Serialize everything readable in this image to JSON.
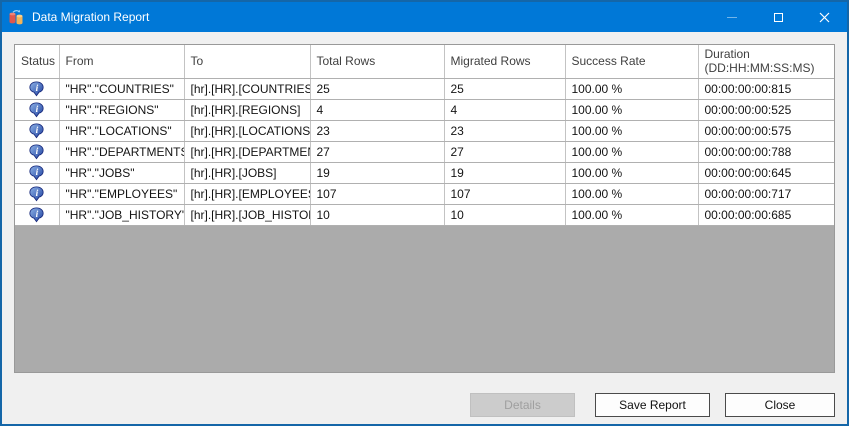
{
  "window": {
    "title": "Data Migration Report",
    "app_icon": "data-migration-icon",
    "controls": {
      "minimize": "minimize",
      "maximize": "maximize",
      "close": "close"
    }
  },
  "table": {
    "columns": [
      "Status",
      "From",
      "To",
      "Total Rows",
      "Migrated Rows",
      "Success Rate",
      "Duration\n(DD:HH:MM:SS:MS)"
    ],
    "status_icon": "info-balloon-icon",
    "rows": [
      {
        "status": "info",
        "from": "\"HR\".\"COUNTRIES\"",
        "to": "[hr].[HR].[COUNTRIES]",
        "total_rows": "25",
        "migrated_rows": "25",
        "success_rate": "100.00 %",
        "duration": "00:00:00:00:815"
      },
      {
        "status": "info",
        "from": "\"HR\".\"REGIONS\"",
        "to": "[hr].[HR].[REGIONS]",
        "total_rows": "4",
        "migrated_rows": "4",
        "success_rate": "100.00 %",
        "duration": "00:00:00:00:525"
      },
      {
        "status": "info",
        "from": "\"HR\".\"LOCATIONS\"",
        "to": "[hr].[HR].[LOCATIONS]",
        "total_rows": "23",
        "migrated_rows": "23",
        "success_rate": "100.00 %",
        "duration": "00:00:00:00:575"
      },
      {
        "status": "info",
        "from": "\"HR\".\"DEPARTMENTS\"",
        "to": "[hr].[HR].[DEPARTMENTS]",
        "total_rows": "27",
        "migrated_rows": "27",
        "success_rate": "100.00 %",
        "duration": "00:00:00:00:788"
      },
      {
        "status": "info",
        "from": "\"HR\".\"JOBS\"",
        "to": "[hr].[HR].[JOBS]",
        "total_rows": "19",
        "migrated_rows": "19",
        "success_rate": "100.00 %",
        "duration": "00:00:00:00:645"
      },
      {
        "status": "info",
        "from": "\"HR\".\"EMPLOYEES\"",
        "to": "[hr].[HR].[EMPLOYEES]",
        "total_rows": "107",
        "migrated_rows": "107",
        "success_rate": "100.00 %",
        "duration": "00:00:00:00:717"
      },
      {
        "status": "info",
        "from": "\"HR\".\"JOB_HISTORY\"",
        "to": "[hr].[HR].[JOB_HISTORY]",
        "total_rows": "10",
        "migrated_rows": "10",
        "success_rate": "100.00 %",
        "duration": "00:00:00:00:685"
      }
    ]
  },
  "footer": {
    "details_label": "Details",
    "save_report_label": "Save Report",
    "close_label": "Close"
  },
  "colors": {
    "titlebar": "#0078d7",
    "window_border": "#1466a8",
    "client_bg": "#f0f0f0",
    "grid_empty_bg": "#ababab",
    "gridline": "#c3c3c3",
    "status_icon_blue": "#2b50a8"
  }
}
